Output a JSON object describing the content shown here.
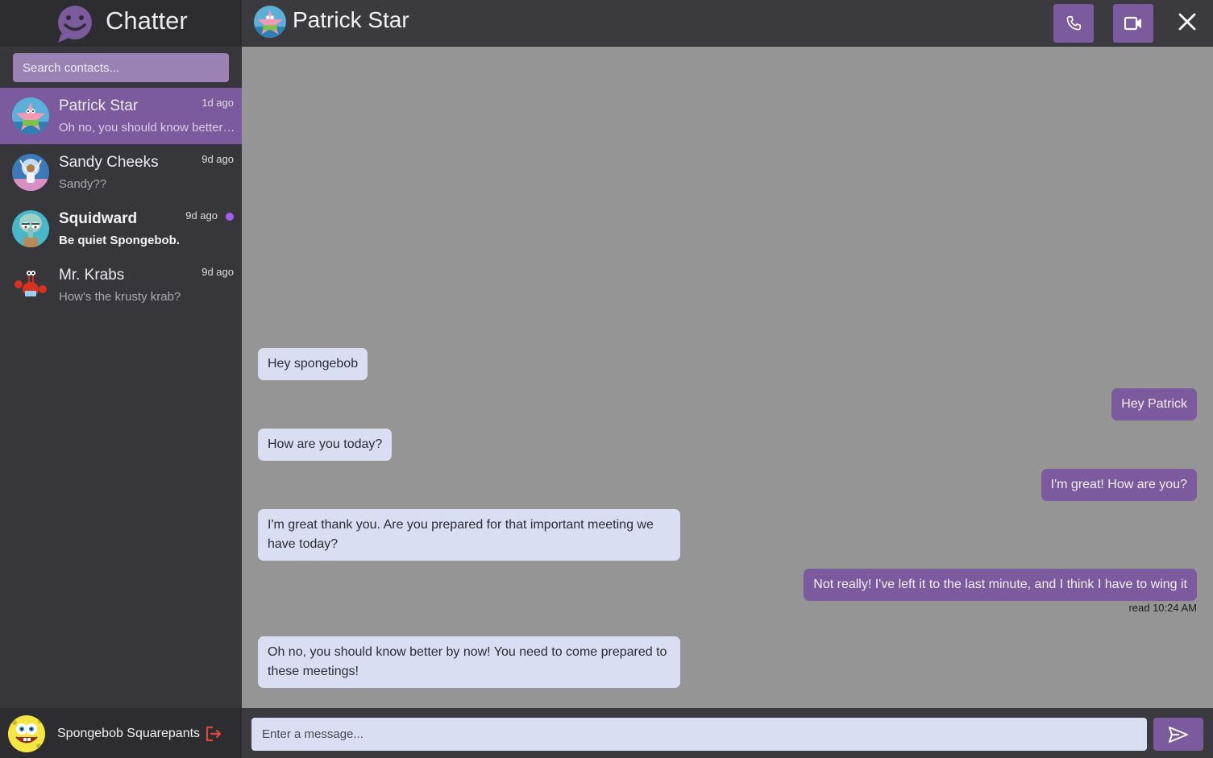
{
  "app": {
    "name": "Chatter"
  },
  "search": {
    "placeholder": "Search contacts..."
  },
  "contacts": [
    {
      "name": "Patrick Star",
      "time": "1d ago",
      "preview": "Oh no, you should know better by now! You need to come prepared to these meetings!",
      "active": true,
      "unread": false,
      "avatar": "patrick-avatar"
    },
    {
      "name": "Sandy Cheeks",
      "time": "9d ago",
      "preview": "Sandy??",
      "active": false,
      "unread": false,
      "avatar": "sandy-avatar"
    },
    {
      "name": "Squidward",
      "time": "9d ago",
      "preview": "Be quiet Spongebob.",
      "active": false,
      "unread": true,
      "avatar": "squidward-avatar"
    },
    {
      "name": "Mr. Krabs",
      "time": "9d ago",
      "preview": "How's the krusty krab?",
      "active": false,
      "unread": false,
      "avatar": "krabs-avatar"
    }
  ],
  "current_user": {
    "name": "Spongebob Squarepants",
    "avatar": "spongebob-avatar"
  },
  "chat": {
    "contact_name": "Patrick Star",
    "messages": [
      {
        "text": "Hey spongebob",
        "from": "them"
      },
      {
        "text": "Hey Patrick",
        "from": "me"
      },
      {
        "text": "How are you today?",
        "from": "them"
      },
      {
        "text": "I'm great! How are you?",
        "from": "me"
      },
      {
        "text": "I'm great thank you. Are you prepared for that important meeting we have today?",
        "from": "them"
      },
      {
        "text": "Not really! I've left it to the last minute, and I think I have to wing it",
        "from": "me"
      },
      {
        "text": "Oh no, you should know better by now! You need to come prepared to these meetings!",
        "from": "them"
      }
    ],
    "read_receipt": "read 10:24 AM"
  },
  "composer": {
    "placeholder": "Enter a message..."
  },
  "icons": {
    "brand": "chat-bubble-smile-icon",
    "call": "phone-icon",
    "video": "video-camera-icon",
    "close": "close-icon",
    "logout": "logout-icon",
    "send": "send-icon"
  },
  "colors": {
    "accent": "#7c5a9e",
    "unread_dot": "#a45cf0",
    "logout": "#e0453a",
    "incoming_bubble": "#d9def3"
  }
}
